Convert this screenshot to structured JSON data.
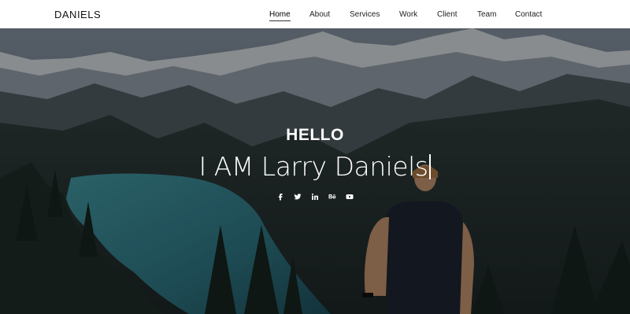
{
  "brand": {
    "name": "DANIELS"
  },
  "nav": {
    "items": [
      {
        "label": "Home",
        "active": true
      },
      {
        "label": "About",
        "active": false
      },
      {
        "label": "Services",
        "active": false
      },
      {
        "label": "Work",
        "active": false
      },
      {
        "label": "Client",
        "active": false
      },
      {
        "label": "Team",
        "active": false
      },
      {
        "label": "Contact",
        "active": false
      }
    ]
  },
  "hero": {
    "greeting": "HELLO",
    "headline": "I AM Larry Daniels",
    "socials": [
      {
        "name": "facebook-icon",
        "glyph": "f"
      },
      {
        "name": "twitter-icon",
        "glyph": "t"
      },
      {
        "name": "linkedin-icon",
        "glyph": "in"
      },
      {
        "name": "behance-icon",
        "glyph": "Bē"
      },
      {
        "name": "youtube-icon",
        "glyph": "yt"
      }
    ]
  }
}
